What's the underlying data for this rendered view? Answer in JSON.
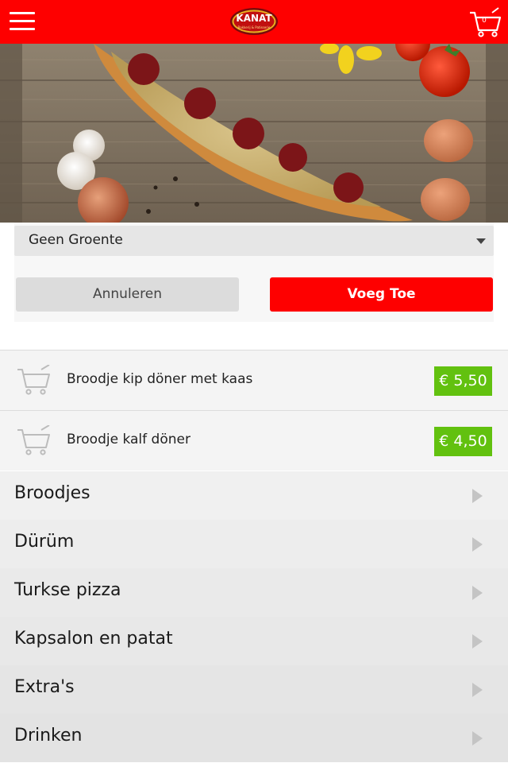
{
  "header": {
    "logo_text": "KANAT",
    "logo_subtext": "Bakkerij & Patisserie",
    "cart_count": "0",
    "brand_color": "#fe0000"
  },
  "options": {
    "select_value": "Geen Groente",
    "cancel_label": "Annuleren",
    "add_label": "Voeg Toe"
  },
  "cart_items": [
    {
      "name": "Broodje kip döner met kaas",
      "price": "€ 5,50"
    },
    {
      "name": "Broodje kalf döner",
      "price": "€ 4,50"
    }
  ],
  "categories": [
    {
      "label": "Broodjes"
    },
    {
      "label": "Dürüm"
    },
    {
      "label": "Turkse pizza"
    },
    {
      "label": "Kapsalon en patat"
    },
    {
      "label": "Extra's"
    },
    {
      "label": "Drinken"
    }
  ],
  "colors": {
    "accent": "#fe0000",
    "price_badge": "#62c10f",
    "category_bg_top": "#f2f2f2",
    "category_bg_bottom": "#e2e2e2"
  }
}
